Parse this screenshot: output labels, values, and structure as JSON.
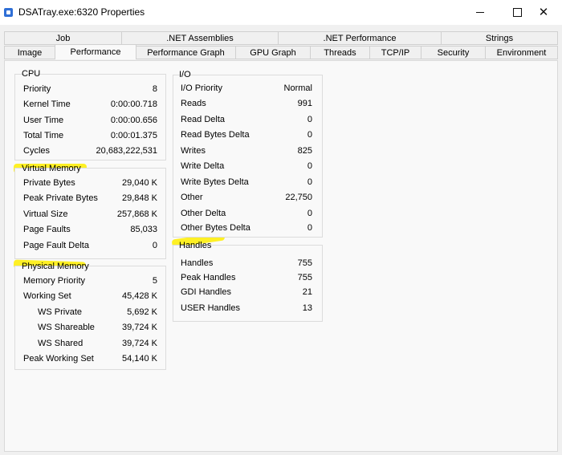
{
  "window": {
    "title": "DSATray.exe:6320 Properties",
    "icon": "app-window-icon",
    "minimize_icon": "minimize-icon",
    "maximize_icon": "maximize-icon",
    "close_icon": "close-icon",
    "minimize_glyph": "",
    "close_glyph": "✕"
  },
  "tabs_row1": [
    "Job",
    ".NET Assemblies",
    ".NET Performance",
    "Strings"
  ],
  "tabs_row2": [
    "Image",
    "Performance",
    "Performance Graph",
    "GPU Graph",
    "Threads",
    "TCP/IP",
    "Security",
    "Environment"
  ],
  "selected_tab": "Performance",
  "cpu": {
    "title": "CPU",
    "rows": [
      {
        "label": "Priority",
        "value": "8"
      },
      {
        "label": "Kernel Time",
        "value": "0:00:00.718"
      },
      {
        "label": "User Time",
        "value": "0:00:00.656"
      },
      {
        "label": "Total Time",
        "value": "0:00:01.375"
      },
      {
        "label": "Cycles",
        "value": "20,683,222,531"
      }
    ]
  },
  "virtual_memory": {
    "title": "Virtual Memory",
    "rows": [
      {
        "label": "Private Bytes",
        "value": "29,040 K"
      },
      {
        "label": "Peak Private Bytes",
        "value": "29,848 K"
      },
      {
        "label": "Virtual Size",
        "value": "257,868 K"
      },
      {
        "label": "Page Faults",
        "value": "85,033"
      },
      {
        "label": "Page Fault Delta",
        "value": "0"
      }
    ]
  },
  "physical_memory": {
    "title": "Physical Memory",
    "rows": [
      {
        "label": "Memory Priority",
        "value": "5"
      },
      {
        "label": "Working Set",
        "value": "45,428 K"
      },
      {
        "label": "WS Private",
        "value": "5,692 K"
      },
      {
        "label": "WS Shareable",
        "value": "39,724 K"
      },
      {
        "label": "WS Shared",
        "value": "39,724 K"
      },
      {
        "label": "Peak Working Set",
        "value": "54,140 K"
      }
    ]
  },
  "io": {
    "title": "I/O",
    "rows": [
      {
        "label": "I/O Priority",
        "value": "Normal"
      },
      {
        "label": "Reads",
        "value": "991"
      },
      {
        "label": "Read Delta",
        "value": "0"
      },
      {
        "label": "Read Bytes Delta",
        "value": "0"
      },
      {
        "label": "Writes",
        "value": "825"
      },
      {
        "label": "Write Delta",
        "value": "0"
      },
      {
        "label": "Write Bytes Delta",
        "value": "0"
      },
      {
        "label": "Other",
        "value": "22,750"
      },
      {
        "label": "Other Delta",
        "value": "0"
      },
      {
        "label": "Other Bytes Delta",
        "value": "0"
      }
    ]
  },
  "handles": {
    "title": "Handles",
    "rows": [
      {
        "label": "Handles",
        "value": "755"
      },
      {
        "label": "Peak Handles",
        "value": "755"
      },
      {
        "label": "GDI Handles",
        "value": "21"
      },
      {
        "label": "USER Handles",
        "value": "13"
      }
    ]
  },
  "colors": {
    "highlight": "#ffee00",
    "panel_bg": "#f9f9f9",
    "window_bg": "#f0f0f0",
    "border": "#dcdcdc"
  }
}
